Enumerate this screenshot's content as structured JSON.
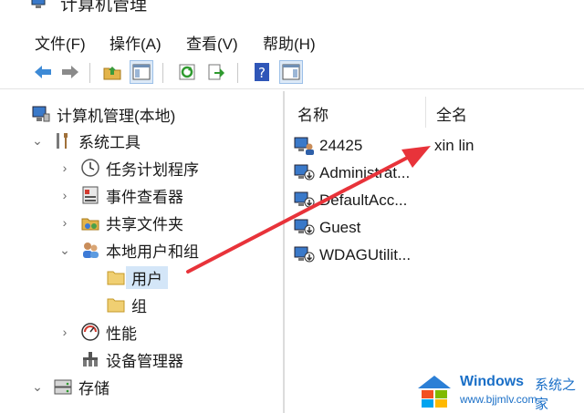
{
  "window": {
    "title": "计算机管理"
  },
  "menu": [
    "文件(F)",
    "操作(A)",
    "查看(V)",
    "帮助(H)"
  ],
  "toolbar": {
    "buttons": [
      "back-icon",
      "forward-icon",
      "folder-up-icon",
      "show-tree-icon",
      "refresh-icon",
      "export-icon",
      "help-icon",
      "show-action-pane-icon"
    ]
  },
  "tree": {
    "root": "计算机管理(本地)",
    "system_tools": "系统工具",
    "task_scheduler": "任务计划程序",
    "event_viewer": "事件查看器",
    "shared_folders": "共享文件夹",
    "local_users_groups": "本地用户和组",
    "users": "用户",
    "groups": "组",
    "performance": "性能",
    "device_manager": "设备管理器",
    "storage": "存储"
  },
  "list": {
    "columns": {
      "name": "名称",
      "fullname": "全名"
    },
    "rows": [
      {
        "name": "24425",
        "fullname": "xin lin"
      },
      {
        "name": "Administrat...",
        "fullname": ""
      },
      {
        "name": "DefaultAcc...",
        "fullname": ""
      },
      {
        "name": "Guest",
        "fullname": ""
      },
      {
        "name": "WDAGUtilit...",
        "fullname": ""
      }
    ]
  },
  "watermark": {
    "brand": "Windows",
    "brand_suffix": "系统之家",
    "url": "www.bjjmlv.com"
  },
  "colors": {
    "selection": "#d4e6f8",
    "arrow": "#e8333a",
    "watermark": "#1a6fc7"
  }
}
